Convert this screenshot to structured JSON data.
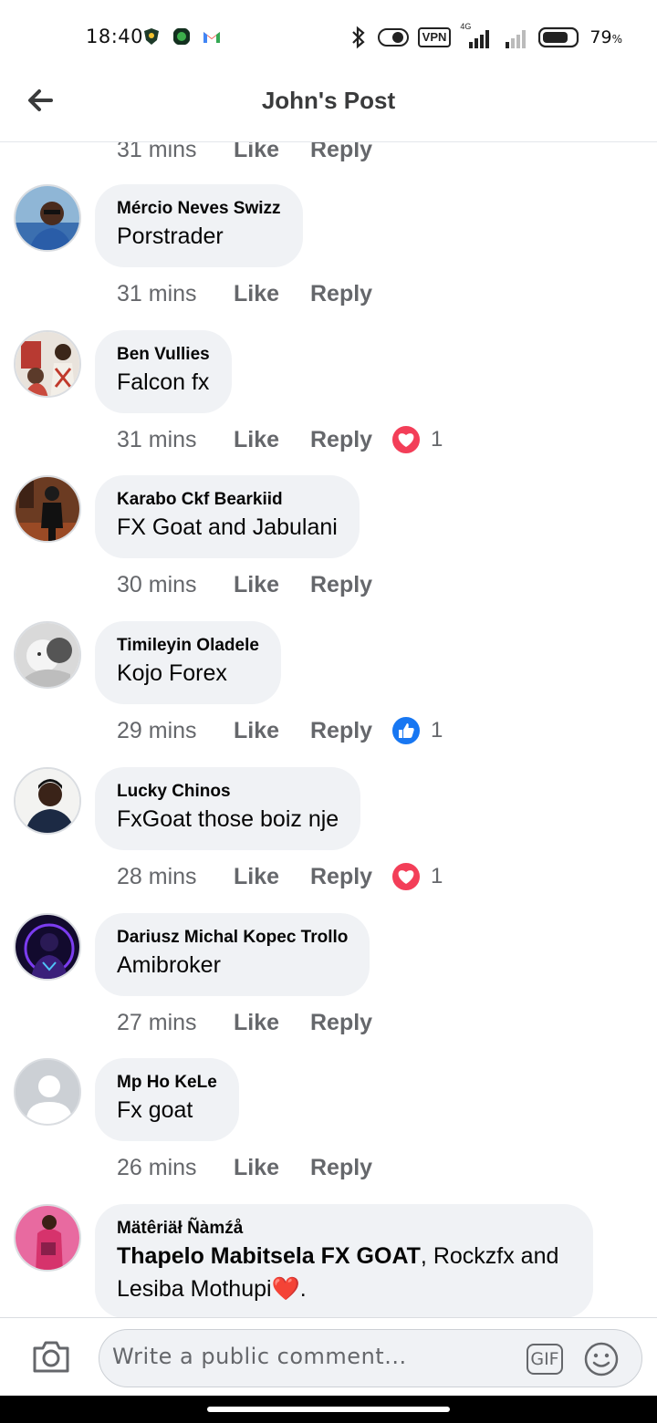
{
  "status_bar": {
    "time": "18:40",
    "battery_percent": "79",
    "battery_unit": "%",
    "vpn_label": "VPN",
    "network_label": "4G",
    "battery_level": 0.79,
    "icons": [
      "app-shield-icon",
      "app-green-icon",
      "gmail-icon",
      "bluetooth-icon",
      "toggle-icon",
      "vpn-icon",
      "signal-icon",
      "signal-weak-icon",
      "battery-icon"
    ]
  },
  "header": {
    "title": "John's Post",
    "back_icon": "arrow-left-icon"
  },
  "top_partial_row": {
    "time": "31 mins",
    "like": "Like",
    "reply": "Reply"
  },
  "comments": [
    {
      "name": "Mércio Neves Swizz",
      "text": "Porstrader",
      "time": "31 mins",
      "like": "Like",
      "reply": "Reply",
      "reaction": null,
      "reaction_count": ""
    },
    {
      "name": "Ben Vullies",
      "text": "Falcon fx",
      "time": "31 mins",
      "like": "Like",
      "reply": "Reply",
      "reaction": "love",
      "reaction_count": "1"
    },
    {
      "name": "Karabo Ckf Bearkiid",
      "text": "FX Goat and Jabulani",
      "time": "30 mins",
      "like": "Like",
      "reply": "Reply",
      "reaction": null,
      "reaction_count": ""
    },
    {
      "name": "Timileyin Oladele",
      "text": "Kojo Forex",
      "time": "29 mins",
      "like": "Like",
      "reply": "Reply",
      "reaction": "like",
      "reaction_count": "1"
    },
    {
      "name": "Lucky Chinos",
      "text": "FxGoat those boiz nje",
      "time": "28 mins",
      "like": "Like",
      "reply": "Reply",
      "reaction": "love",
      "reaction_count": "1"
    },
    {
      "name": "Dariusz Michal Kopec Trollo",
      "text": "Amibroker",
      "time": "27 mins",
      "like": "Like",
      "reply": "Reply",
      "reaction": null,
      "reaction_count": ""
    },
    {
      "name": "Mp Ho KeLe",
      "text": "Fx goat",
      "time": "26 mins",
      "like": "Like",
      "reply": "Reply",
      "reaction": null,
      "reaction_count": ""
    }
  ],
  "last_comment": {
    "name": "Mätêriäł Ñàmźå",
    "bold_mention": "Thapelo Mabitsela FX GOAT",
    "rest_line1": ", Rockzfx and",
    "line2": "Lesiba Mothupi",
    "heart_emoji": "❤️",
    "end": "."
  },
  "composer": {
    "placeholder": "Write a public comment...",
    "gif_label": "GIF",
    "camera_icon": "camera-icon",
    "emoji_icon": "emoji-icon"
  },
  "colors": {
    "bubble": "#f0f2f5",
    "meta_text": "#65676b",
    "love": "#f33e58",
    "like": "#1877f2"
  }
}
